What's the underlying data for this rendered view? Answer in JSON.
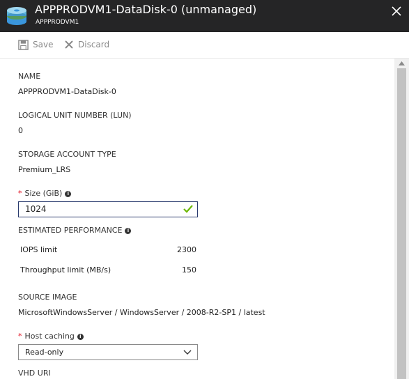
{
  "header": {
    "title": "APPPRODVM1-DataDisk-0 (unmanaged)",
    "subtitle": "APPPRODVM1",
    "icon": "disk-icon",
    "close_icon": "close-icon"
  },
  "toolbar": {
    "save_label": "Save",
    "discard_label": "Discard"
  },
  "fields": {
    "name_label": "NAME",
    "name_value": "APPPRODVM1-DataDisk-0",
    "lun_label": "LOGICAL UNIT NUMBER (LUN)",
    "lun_value": "0",
    "storage_label": "STORAGE ACCOUNT TYPE",
    "storage_value": "Premium_LRS",
    "size_label": "Size (GiB)",
    "size_value": "1024",
    "perf_label": "ESTIMATED PERFORMANCE",
    "perf_rows": [
      {
        "label": "IOPS limit",
        "value": "2300"
      },
      {
        "label": "Throughput limit (MB/s)",
        "value": "150"
      }
    ],
    "source_label": "SOURCE IMAGE",
    "source_value": "MicrosoftWindowsServer / WindowsServer / 2008-R2-SP1 / latest",
    "caching_label": "Host caching",
    "caching_value": "Read-only",
    "vhd_label": "VHD URI"
  },
  "colors": {
    "header_bg": "#252526",
    "required": "#e00b1c",
    "valid_check": "#6bb700",
    "input_border": "#2a3b6e"
  }
}
